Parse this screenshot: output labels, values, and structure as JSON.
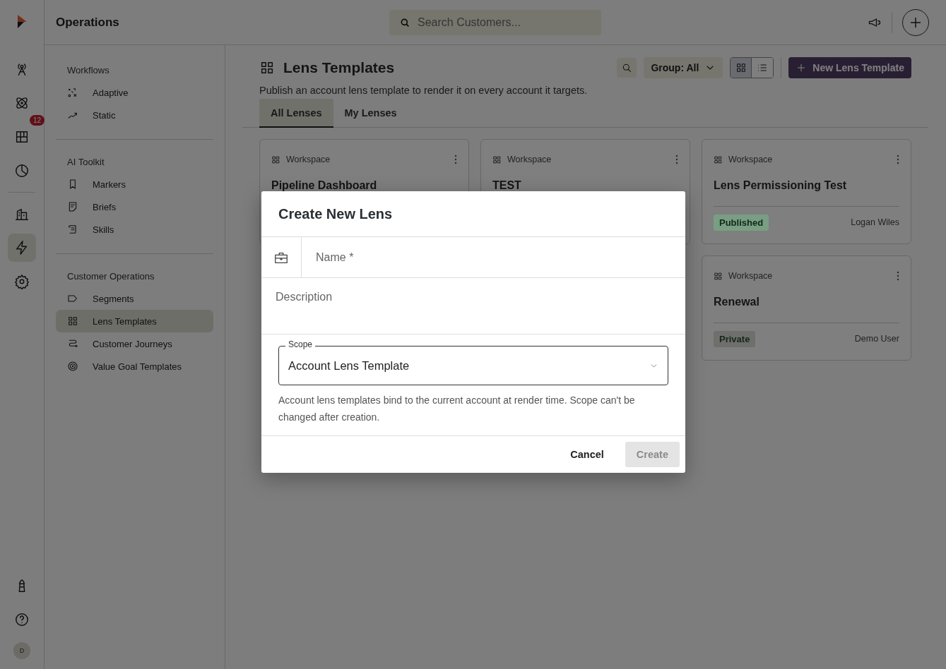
{
  "rail": {
    "primary": [
      {
        "kind": "antenna",
        "selected": false
      },
      {
        "kind": "atom",
        "selected": false
      },
      {
        "kind": "board",
        "selected": false,
        "badge": "12"
      },
      {
        "kind": "pie",
        "selected": false
      }
    ],
    "secondary": [
      {
        "kind": "building",
        "selected": false
      },
      {
        "kind": "bolt",
        "selected": true
      },
      {
        "kind": "gear",
        "selected": false
      }
    ],
    "footer": [
      {
        "kind": "lighthouse",
        "selected": false
      },
      {
        "kind": "help",
        "selected": false
      }
    ],
    "avatar": "D"
  },
  "topbar": {
    "section_title": "Operations",
    "search": {
      "placeholder": "Search Customers..."
    }
  },
  "sidebar": {
    "groups": [
      {
        "heading": "Workflows",
        "items": [
          {
            "label": "Adaptive",
            "kind": "adaptive",
            "selected": false
          },
          {
            "label": "Static",
            "kind": "static",
            "selected": false
          }
        ]
      },
      {
        "heading": "AI Toolkit",
        "items": [
          {
            "label": "Markers",
            "kind": "bookmark",
            "selected": false
          },
          {
            "label": "Briefs",
            "kind": "brief",
            "selected": false
          },
          {
            "label": "Skills",
            "kind": "scroll",
            "selected": false
          }
        ]
      },
      {
        "heading": "Customer Operations",
        "items": [
          {
            "label": "Segments",
            "kind": "tag",
            "selected": false
          },
          {
            "label": "Lens Templates",
            "kind": "grid",
            "selected": true
          },
          {
            "label": "Customer Journeys",
            "kind": "journey",
            "selected": false
          },
          {
            "label": "Value Goal Templates",
            "kind": "target",
            "selected": false
          }
        ]
      }
    ]
  },
  "page": {
    "title": "Lens Templates",
    "subtitle": "Publish an account lens template to render it on every account it targets.",
    "group_filter": "Group: All",
    "view_modes": [
      {
        "kind": "grid",
        "selected": true
      },
      {
        "kind": "list",
        "selected": false
      }
    ],
    "new_button": "New Lens Template",
    "tabs": [
      {
        "label": "All Lenses",
        "selected": true
      },
      {
        "label": "My Lenses",
        "selected": false
      }
    ]
  },
  "cards": [
    {
      "scope": "Workspace",
      "title": "Pipeline Dashboard"
    },
    {
      "scope": "Workspace",
      "title": "TEST"
    },
    {
      "scope": "Workspace",
      "title": "Lens Permissioning Test",
      "status": "Published",
      "color": "#789e83",
      "owner": "Logan Wiles"
    },
    {
      "scope": "Workspace",
      "title": "Renewal",
      "status": "Private",
      "color": "#6f6f6c",
      "owner": "Demo User"
    }
  ],
  "dialog": {
    "title": "Create New Lens",
    "name": {
      "placeholder": "Name *"
    },
    "description": {
      "placeholder": "Description"
    },
    "scope": {
      "label": "Scope",
      "value": "Account Lens Template"
    },
    "help": "Account lens templates bind to the current account at render time. Scope can't be changed after creation.",
    "buttons": [
      {
        "label": "Cancel",
        "kind": "text",
        "disabled": false
      },
      {
        "label": "Create",
        "kind": "primary",
        "disabled": true
      }
    ]
  }
}
